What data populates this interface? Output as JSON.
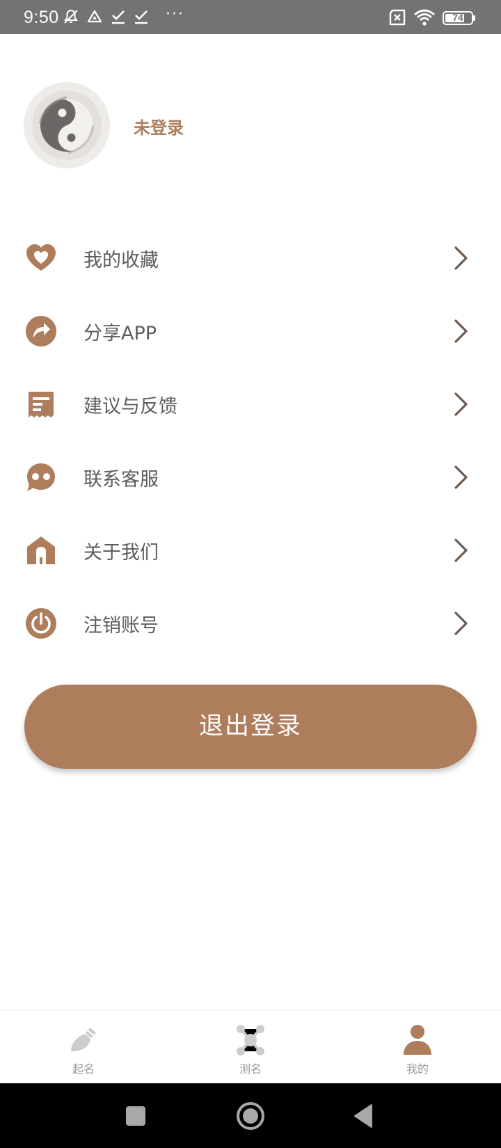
{
  "status_bar": {
    "time": "9:50",
    "dots": "···",
    "battery": "74",
    "battery_level": 0.74
  },
  "profile": {
    "name": "未登录"
  },
  "menu": {
    "items": [
      {
        "label": "我的收藏",
        "icon": "heart-icon"
      },
      {
        "label": "分享APP",
        "icon": "share-icon"
      },
      {
        "label": "建议与反馈",
        "icon": "feedback-icon"
      },
      {
        "label": "联系客服",
        "icon": "chat-icon"
      },
      {
        "label": "关于我们",
        "icon": "home-icon"
      },
      {
        "label": "注销账号",
        "icon": "power-icon"
      }
    ]
  },
  "logout_button": {
    "label": "退出登录"
  },
  "tabs": [
    {
      "label": "起名",
      "icon": "brush-icon",
      "active": false
    },
    {
      "label": "测名",
      "icon": "network-icon",
      "active": false
    },
    {
      "label": "我的",
      "icon": "person-icon",
      "active": true
    }
  ],
  "colors": {
    "accent": "#ad7d5c",
    "inactive": "#cccccc",
    "text": "#5d5d5d",
    "status_bar": "#737373"
  }
}
